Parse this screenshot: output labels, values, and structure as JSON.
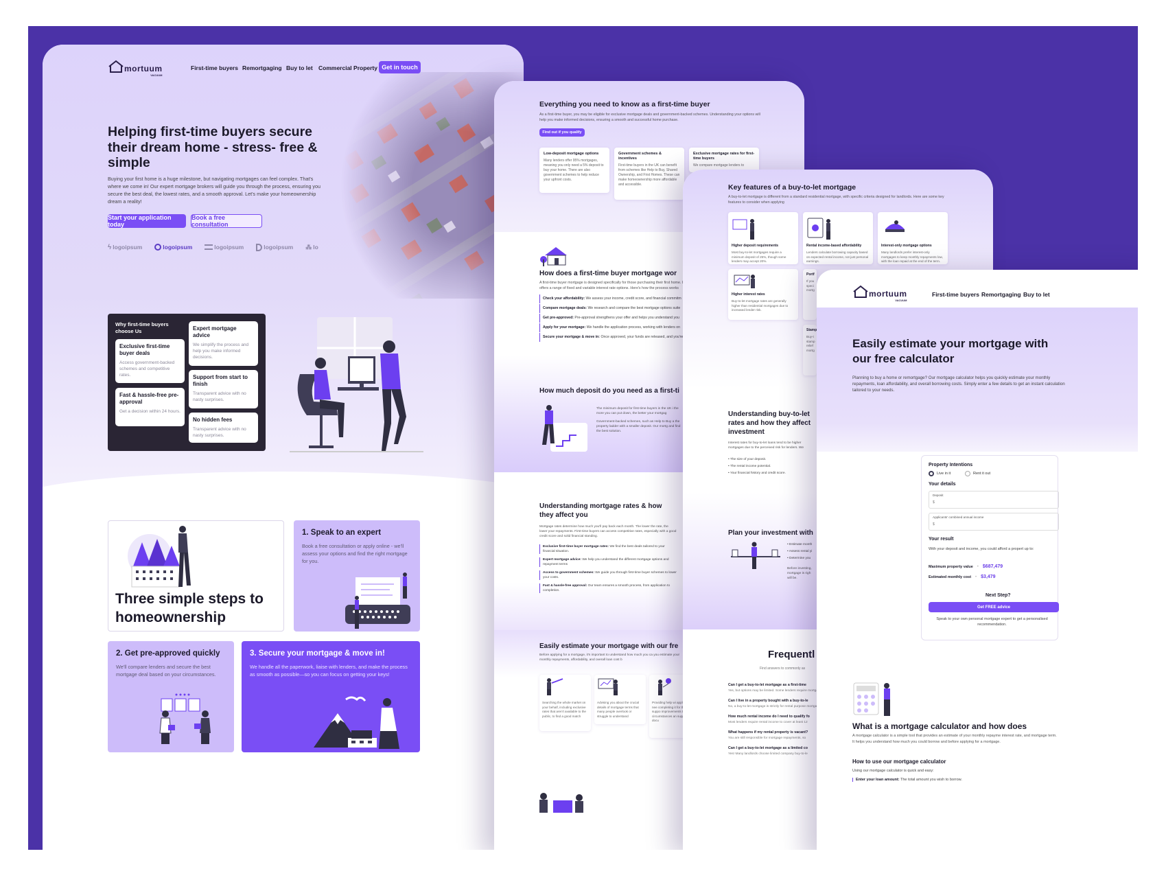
{
  "brand": {
    "name": "mortuum",
    "sub": "VACUUM"
  },
  "colors": {
    "accent": "#7a4ef5",
    "background": "#4b32a7",
    "lavender": "#ddd3fb"
  },
  "p1": {
    "nav": [
      "First-time buyers",
      "Remortgaging",
      "Buy to let",
      "Commercial Property"
    ],
    "cta": "Get in touch",
    "hero": {
      "title": "Helping first-time buyers secure their dream home - stress- free & simple",
      "desc": "Buying your first home is a huge milestone, but navigating mortgages can feel complex. That's where we come in! Our expert mortgage brokers will guide you through the process, ensuring you secure the best deal, the lowest rates, and a smooth approval. Let's make your homeownership dream a reality!",
      "primary": "Start your application today",
      "secondary": "Book a free consultation"
    },
    "logos": [
      "logoipsum",
      "logoipsum",
      "logoipsum",
      "logoipsum",
      "lo"
    ],
    "why": {
      "title": "Why first-time buyers choose Us",
      "cards": [
        {
          "t": "Exclusive first-time buyer deals",
          "d": "Access government-backed schemes and competitive rates."
        },
        {
          "t": "Fast & hassle-free pre-approval",
          "d": "Get a decision within 24 hours."
        },
        {
          "t": "Expert mortgage advice",
          "d": "We simplify the process and help you make informed decisions."
        },
        {
          "t": "Support from start to finish",
          "d": "Transparent advice with no nasty surprises."
        },
        {
          "t": "No hidden fees",
          "d": "Transparent advice with no nasty surprises."
        }
      ]
    },
    "steps": {
      "title": "Three simple steps to homeownership",
      "s1": {
        "t": "1. Speak to an expert",
        "d": "Book a free consultation or apply online - we'll assess your options and find the right mortgage for you."
      },
      "s2": {
        "t": "2. Get pre-approved quickly",
        "d": "We'll compare lenders and secure the best mortgage deal based on your circumstances."
      },
      "s3": {
        "t": "3. Secure your mortgage & move in!",
        "d": "We handle all the paperwork, liaise with lenders, and make the process as smooth as possible—so you can focus on getting your keys!"
      }
    }
  },
  "p2": {
    "title": "Everything you need to know as a first-time buyer",
    "desc": "As a first-time buyer, you may be eligible for exclusive mortgage deals and government-backed schemes. Understanding your options will help you make informed decisions, ensuring a smooth and successful home purchase.",
    "btn": "Find out if you qualify",
    "cards": [
      {
        "t": "Low-deposit mortgage options",
        "d": "Many lenders offer 95% mortgages, meaning you only need a 5% deposit to buy your home. There are also government schemes to help reduce your upfront costs."
      },
      {
        "t": "Government schemes & incentives",
        "d": "First-time buyers in the UK can benefit from schemes like Help to Buy, Shared Ownership, and First Homes. These can make homeownership more affordable and accessible."
      },
      {
        "t": "Exclusive mortgage rates for first-time buyers",
        "d": "We compare mortgage lenders to"
      }
    ],
    "how": {
      "title": "How does a first-time buyer mortgage wor",
      "desc": "A first-time buyer mortgage is designed specifically for those purchasing their first home. It offers a range of fixed and variable interest rate options. Here's how the process works",
      "list": [
        {
          "b": "Check your affordability:",
          "t": " We assess your income, credit score, and financial commitm"
        },
        {
          "b": "Compare mortgage deals:",
          "t": " We research and compare the best mortgage options suite"
        },
        {
          "b": "Get pre-approved:",
          "t": " Pre-approval strengthens your offer and helps you understand you"
        },
        {
          "b": "Apply for your mortgage:",
          "t": " We handle the application process, working with lenders on"
        },
        {
          "b": "Secure your mortgage & move in:",
          "t": " Once approved, your funds are released, and you're"
        }
      ]
    },
    "deposit": {
      "title": "How much deposit do you need as a first-ti",
      "p1": "The minimum deposit for first-time buyers in the UK i the more you can put down, the better your mortgag",
      "p2": "Government-backed schemes, such as Help to Buy a the property ladder with a smaller deposit. Our mortg and find the best solution."
    },
    "rates": {
      "title": "Understanding mortgage rates & how they affect you",
      "desc": "Mortgage rates determine how much you'll pay back each month. The lower the rate, the lower your repayments. First-time buyers can access competitive rates, especially with a good credit score and solid financial standing.",
      "list": [
        {
          "b": "Exclusive first-time buyer mortgage rates:",
          "t": " We find the best deals tailored to your financial situation."
        },
        {
          "b": "Expert mortgage advice:",
          "t": " We help you understand the different mortgage options and repayment terms"
        },
        {
          "b": "Access to government schemes:",
          "t": " We guide you through first-time buyer schemes to lower your costs."
        },
        {
          "b": "Fast & hassle-free approval:",
          "t": " Our team ensures a smooth process, from application to completion."
        }
      ]
    },
    "estimate": {
      "title": "Easily estimate your mortgage with our fre",
      "desc": "Before applying for a mortgage, it's important to understand how much you ca you estimate your monthly repayments, affordability, and overall loan cost b",
      "cards": [
        "Searching the whole market on your behalf, including exclusive rates that aren't available to the public, to find a good match",
        "Advising you about the crucial details of mortgage terms that many people overlook or struggle to understand",
        "Providing help wi application if nee completing it for through to suppo improvements to circumstances an supporting docu"
      ]
    }
  },
  "p3": {
    "title": "Key features of a buy-to-let mortgage",
    "desc": "A buy-to-let mortgage is different from a standard residential mortgage, with specific criteria designed for landlords. Here are some key features to consider when applying",
    "cards": [
      {
        "t": "Higher deposit requirements",
        "d": "Most buy-to-let mortgages require a minimum deposit of 25%, though some lenders may accept 20%."
      },
      {
        "t": "Rental income-based affordability",
        "d": "Lenders calculate borrowing capacity based on expected rental income, not just personal earnings."
      },
      {
        "t": "Interest-only mortgage options",
        "d": "Many landlords prefer interest-only mortgages to keep monthly repayments low, with the loan repaid at the end of the term."
      },
      {
        "t": "Higher interest rates",
        "d": "Buy-to-let mortgage rates are generally higher than residential mortgages due to increased lender risk."
      },
      {
        "t": "Portf",
        "d": "If you speci mortg"
      },
      {
        "t": "Stamp",
        "d": "Buy-t stamp relief mortg"
      }
    ],
    "understand": {
      "title": "Understanding buy-to-let rates and how they affect investment",
      "desc": "Interest rates for buy-to-let loans tend to be higher mortgages due to the perceived risk for lenders. We",
      "bullets": [
        "The size of your deposit.",
        "The rental income potential.",
        "Your financial history and credit score."
      ]
    },
    "plan": {
      "title": "Plan your investment with",
      "bullets": [
        "Estimate month",
        "Assess rental yi",
        "Determine you"
      ],
      "note": "Before investing, mortgage is righ will be."
    },
    "faq": {
      "title": "Frequentl",
      "sub": "Find answers to commonly as",
      "items": [
        {
          "q": "Can I get a buy-to-let mortgage as a first-time",
          "a": "Yes, but options may be limited. Some lenders require mortgage."
        },
        {
          "q": "Can I live in a property bought with a buy-to-le",
          "a": "No, a buy-to-let mortgage is strictly for rental purpose mortgage."
        },
        {
          "q": "How much rental income do I need to qualify fo",
          "a": "Most lenders require rental income to cover at least 12"
        },
        {
          "q": "What happens if my rental property is vacant?",
          "a": "You are still responsible for mortgage repayments, so"
        },
        {
          "q": "Can I get a buy-to-let mortgage as a limited co",
          "a": "Yes! Many landlords choose limited company buy-to-le"
        }
      ]
    }
  },
  "p4": {
    "nav": [
      "First-time buyers",
      "Remortgaging",
      "Buy to let"
    ],
    "hero": {
      "title": "Easily estimate your mortgage with our free calculator",
      "desc": "Planning to buy a home or remortgage? Our mortgage calculator helps you quickly estimate your monthly repayments, loan affordability, and overall borrowing costs. Simply enter a few details to get an instant calculation tailored to your needs."
    },
    "calc": {
      "intentions": "Property Intentions",
      "opt1": "Live in it",
      "opt2": "Rent it out",
      "details": "Your details",
      "deposit_label": "Deposit",
      "income_label": "Applicants' combined annual income",
      "currency": "$",
      "result": "Your result",
      "result_text": "With your deposit and income, you could afford a propert up to:",
      "max_label": "Maximum property value",
      "max_value": "$687,479",
      "cost_label": "Estimated monthly cost",
      "cost_value": "$3,479",
      "next": "Next Step?",
      "btn": "Get FREE advice",
      "foot": "Speak to your own personal mortgage expert to get a personalised recommendation."
    },
    "what": {
      "title": "What is a mortgage calculator and how does",
      "desc": "A mortgage calculator is a simple tool that provides an estimate of your monthly repayme interest rate, and mortgage term. It helps you understand how much you could borrow and before applying for a mortgage.",
      "how_title": "How to use our mortgage calculator",
      "how_desc": "Using our mortgage calculator is quick and easy:",
      "step_b": "Enter your loan amount:",
      "step_t": " The total amount you wish to borrow."
    }
  }
}
